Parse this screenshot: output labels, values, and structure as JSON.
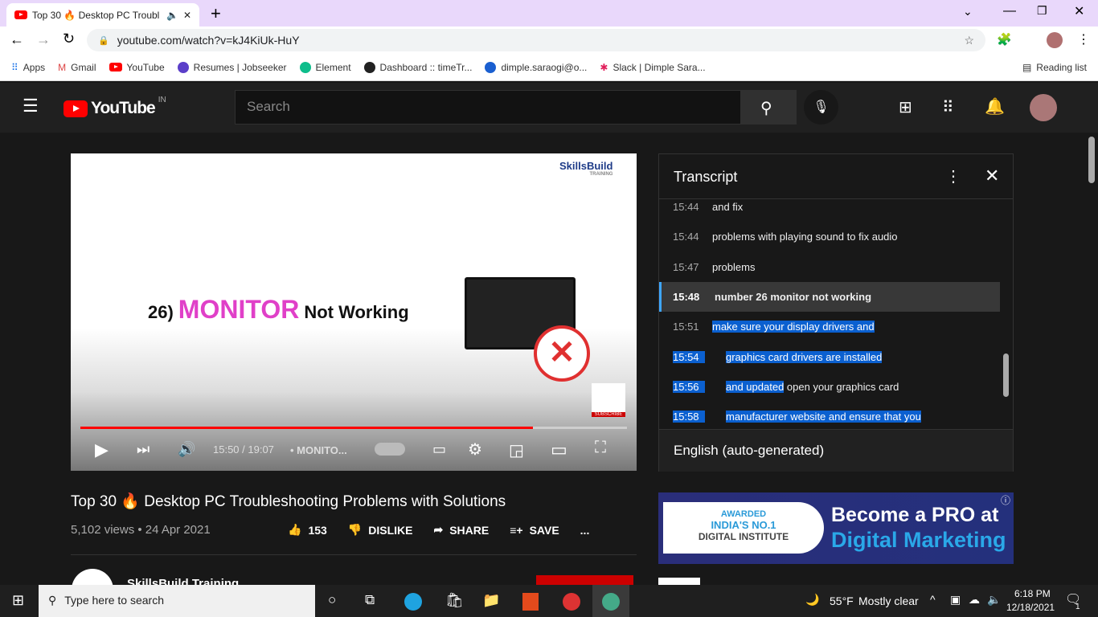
{
  "browser": {
    "tab_title": "Top 30 🔥 Desktop PC Troubl",
    "url": "youtube.com/watch?v=kJ4KiUk-HuY",
    "bookmarks": [
      "Apps",
      "Gmail",
      "YouTube",
      "Resumes | Jobseeker",
      "Element",
      "Dashboard :: timeTr...",
      "dimple.saraogi@o...",
      "Slack | Dimple Sara..."
    ],
    "reading_list": "Reading list"
  },
  "youtube": {
    "logo": "YouTube",
    "region": "IN",
    "search_placeholder": "Search"
  },
  "video": {
    "slide_number": "26)",
    "slide_word": "MONITOR",
    "slide_rest": "Not Working",
    "brand": "SkillsBuild",
    "brand_sub": "TRAINING",
    "subscribe": "SUBSCRIBE",
    "time": "15:50 / 19:07",
    "chapter": "• MONITO...",
    "progress_fraction": 0.828,
    "title": "Top 30 🔥 Desktop PC Troubleshooting Problems with Solutions",
    "meta": "5,102 views • 24 Apr 2021",
    "likes": "153",
    "dislike": "DISLIKE",
    "share": "SHARE",
    "save": "SAVE",
    "more": "...",
    "channel": "SkillsBuild Training"
  },
  "transcript": {
    "title": "Transcript",
    "language": "English (auto-generated)",
    "rows": [
      {
        "time": "15:44",
        "text": "and fix"
      },
      {
        "time": "15:44",
        "text": "problems with playing sound to fix audio"
      },
      {
        "time": "15:47",
        "text": "problems"
      },
      {
        "time": "15:48",
        "text": "number 26 monitor not working",
        "active": true
      },
      {
        "time": "15:51",
        "text": "make sure your display drivers and"
      },
      {
        "time": "15:54",
        "text": "graphics card drivers are installed"
      },
      {
        "time": "15:56",
        "text": "and updated",
        "text2": " open your graphics card"
      },
      {
        "time": "15:58",
        "text": "manufacturer website and ensure that you"
      }
    ]
  },
  "ad": {
    "line1": "AWARDED",
    "line2": "INDIA'S NO.1",
    "line3": "DIGITAL INSTITUTE",
    "head1": "Become a PRO at",
    "head2": "Digital Marketing"
  },
  "taskbar": {
    "search": "Type here to search",
    "weather": "55°F",
    "weather_desc": "Mostly clear",
    "time": "6:18 PM",
    "date": "12/18/2021",
    "notifications": "1"
  },
  "colors": {
    "accent": "#ff0000",
    "selection": "#0b60d0",
    "active_bar": "#3ea6ff"
  }
}
